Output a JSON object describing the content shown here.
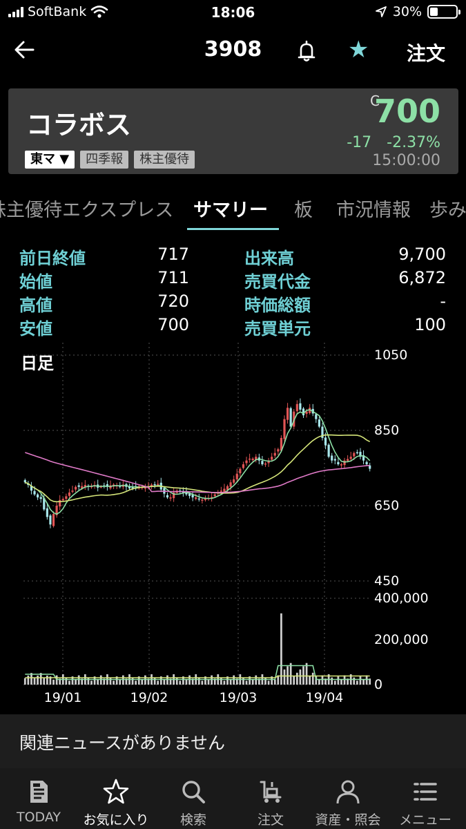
{
  "status_bar": {
    "carrier": "SoftBank",
    "time": "18:06",
    "battery": "30%",
    "battery_level": 0.3
  },
  "nav": {
    "title": "3908",
    "order_label": "注文",
    "back_icon": "arrow-left-icon",
    "bell_icon": "bell-icon",
    "star_icon": "star-icon",
    "star_color": "#7fd6d8"
  },
  "stock": {
    "name": "コラボス",
    "market": "東マ",
    "tag_quarterly": "四季報",
    "tag_benefits": "株主優待",
    "price_flag": "C",
    "price": "700",
    "change": "-17",
    "change_pct": "-2.37%",
    "time": "15:00:00",
    "up_color": "#8de0a6"
  },
  "tabs": [
    {
      "label": "株主優待"
    },
    {
      "label": "エクスプレス"
    },
    {
      "label": "サマリー",
      "active": true
    },
    {
      "label": "板"
    },
    {
      "label": "市況情報"
    },
    {
      "label": "歩み値"
    }
  ],
  "summary": {
    "left": [
      {
        "label": "前日終値",
        "value": "717"
      },
      {
        "label": "始値",
        "value": "711"
      },
      {
        "label": "高値",
        "value": "720"
      },
      {
        "label": "安値",
        "value": "700"
      }
    ],
    "right": [
      {
        "label": "出来高",
        "value": "9,700"
      },
      {
        "label": "売買代金",
        "value": "6,872"
      },
      {
        "label": "時価総額",
        "value": "-"
      },
      {
        "label": "売買単元",
        "value": "100"
      }
    ]
  },
  "chart_data": {
    "type": "candlestick",
    "title": "日足",
    "price_axis": {
      "ticks": [
        "1050",
        "850",
        "650",
        "450"
      ],
      "range": [
        450,
        1050
      ]
    },
    "volume_axis": {
      "ticks": [
        "400,000",
        "200,000",
        "0"
      ],
      "range": [
        0,
        400000
      ]
    },
    "x_labels": [
      "19/01",
      "19/02",
      "19/03",
      "19/04"
    ],
    "up_color": "#e05555",
    "down_color": "#a8e6ea",
    "ma_colors": {
      "short": "#8de0a6",
      "mid": "#d6e67a",
      "long": "#e07ac8"
    },
    "close": [
      712,
      705,
      690,
      680,
      672,
      668,
      640,
      620,
      600,
      628,
      650,
      665,
      668,
      675,
      685,
      690,
      700,
      700,
      702,
      705,
      700,
      702,
      705,
      698,
      701,
      703,
      700,
      704,
      706,
      704,
      700,
      706,
      700,
      696,
      698,
      700,
      702,
      699,
      698,
      700,
      706,
      706,
      708,
      693,
      682,
      672,
      672,
      685,
      690,
      688,
      684,
      680,
      676,
      672,
      672,
      668,
      666,
      670,
      670,
      673,
      680,
      685,
      690,
      695,
      702,
      712,
      720,
      735,
      748,
      760,
      770,
      775,
      775,
      780,
      770,
      760,
      762,
      770,
      780,
      790,
      800,
      830,
      880,
      910,
      860,
      900,
      920,
      905,
      890,
      900,
      910,
      895,
      880,
      860,
      830,
      810,
      780,
      770,
      770,
      760,
      760,
      770,
      774,
      780,
      790,
      790,
      780,
      770,
      760,
      748
    ]
  },
  "news": {
    "text": "関連ニュースがありません"
  },
  "tabbar": [
    {
      "label": "TODAY",
      "icon": "news-icon"
    },
    {
      "label": "お気に入り",
      "icon": "star-outline-icon",
      "active": true
    },
    {
      "label": "検索",
      "icon": "search-icon"
    },
    {
      "label": "注文",
      "icon": "cart-icon"
    },
    {
      "label": "資産・照会",
      "icon": "person-icon"
    },
    {
      "label": "メニュー",
      "icon": "menu-icon"
    }
  ]
}
